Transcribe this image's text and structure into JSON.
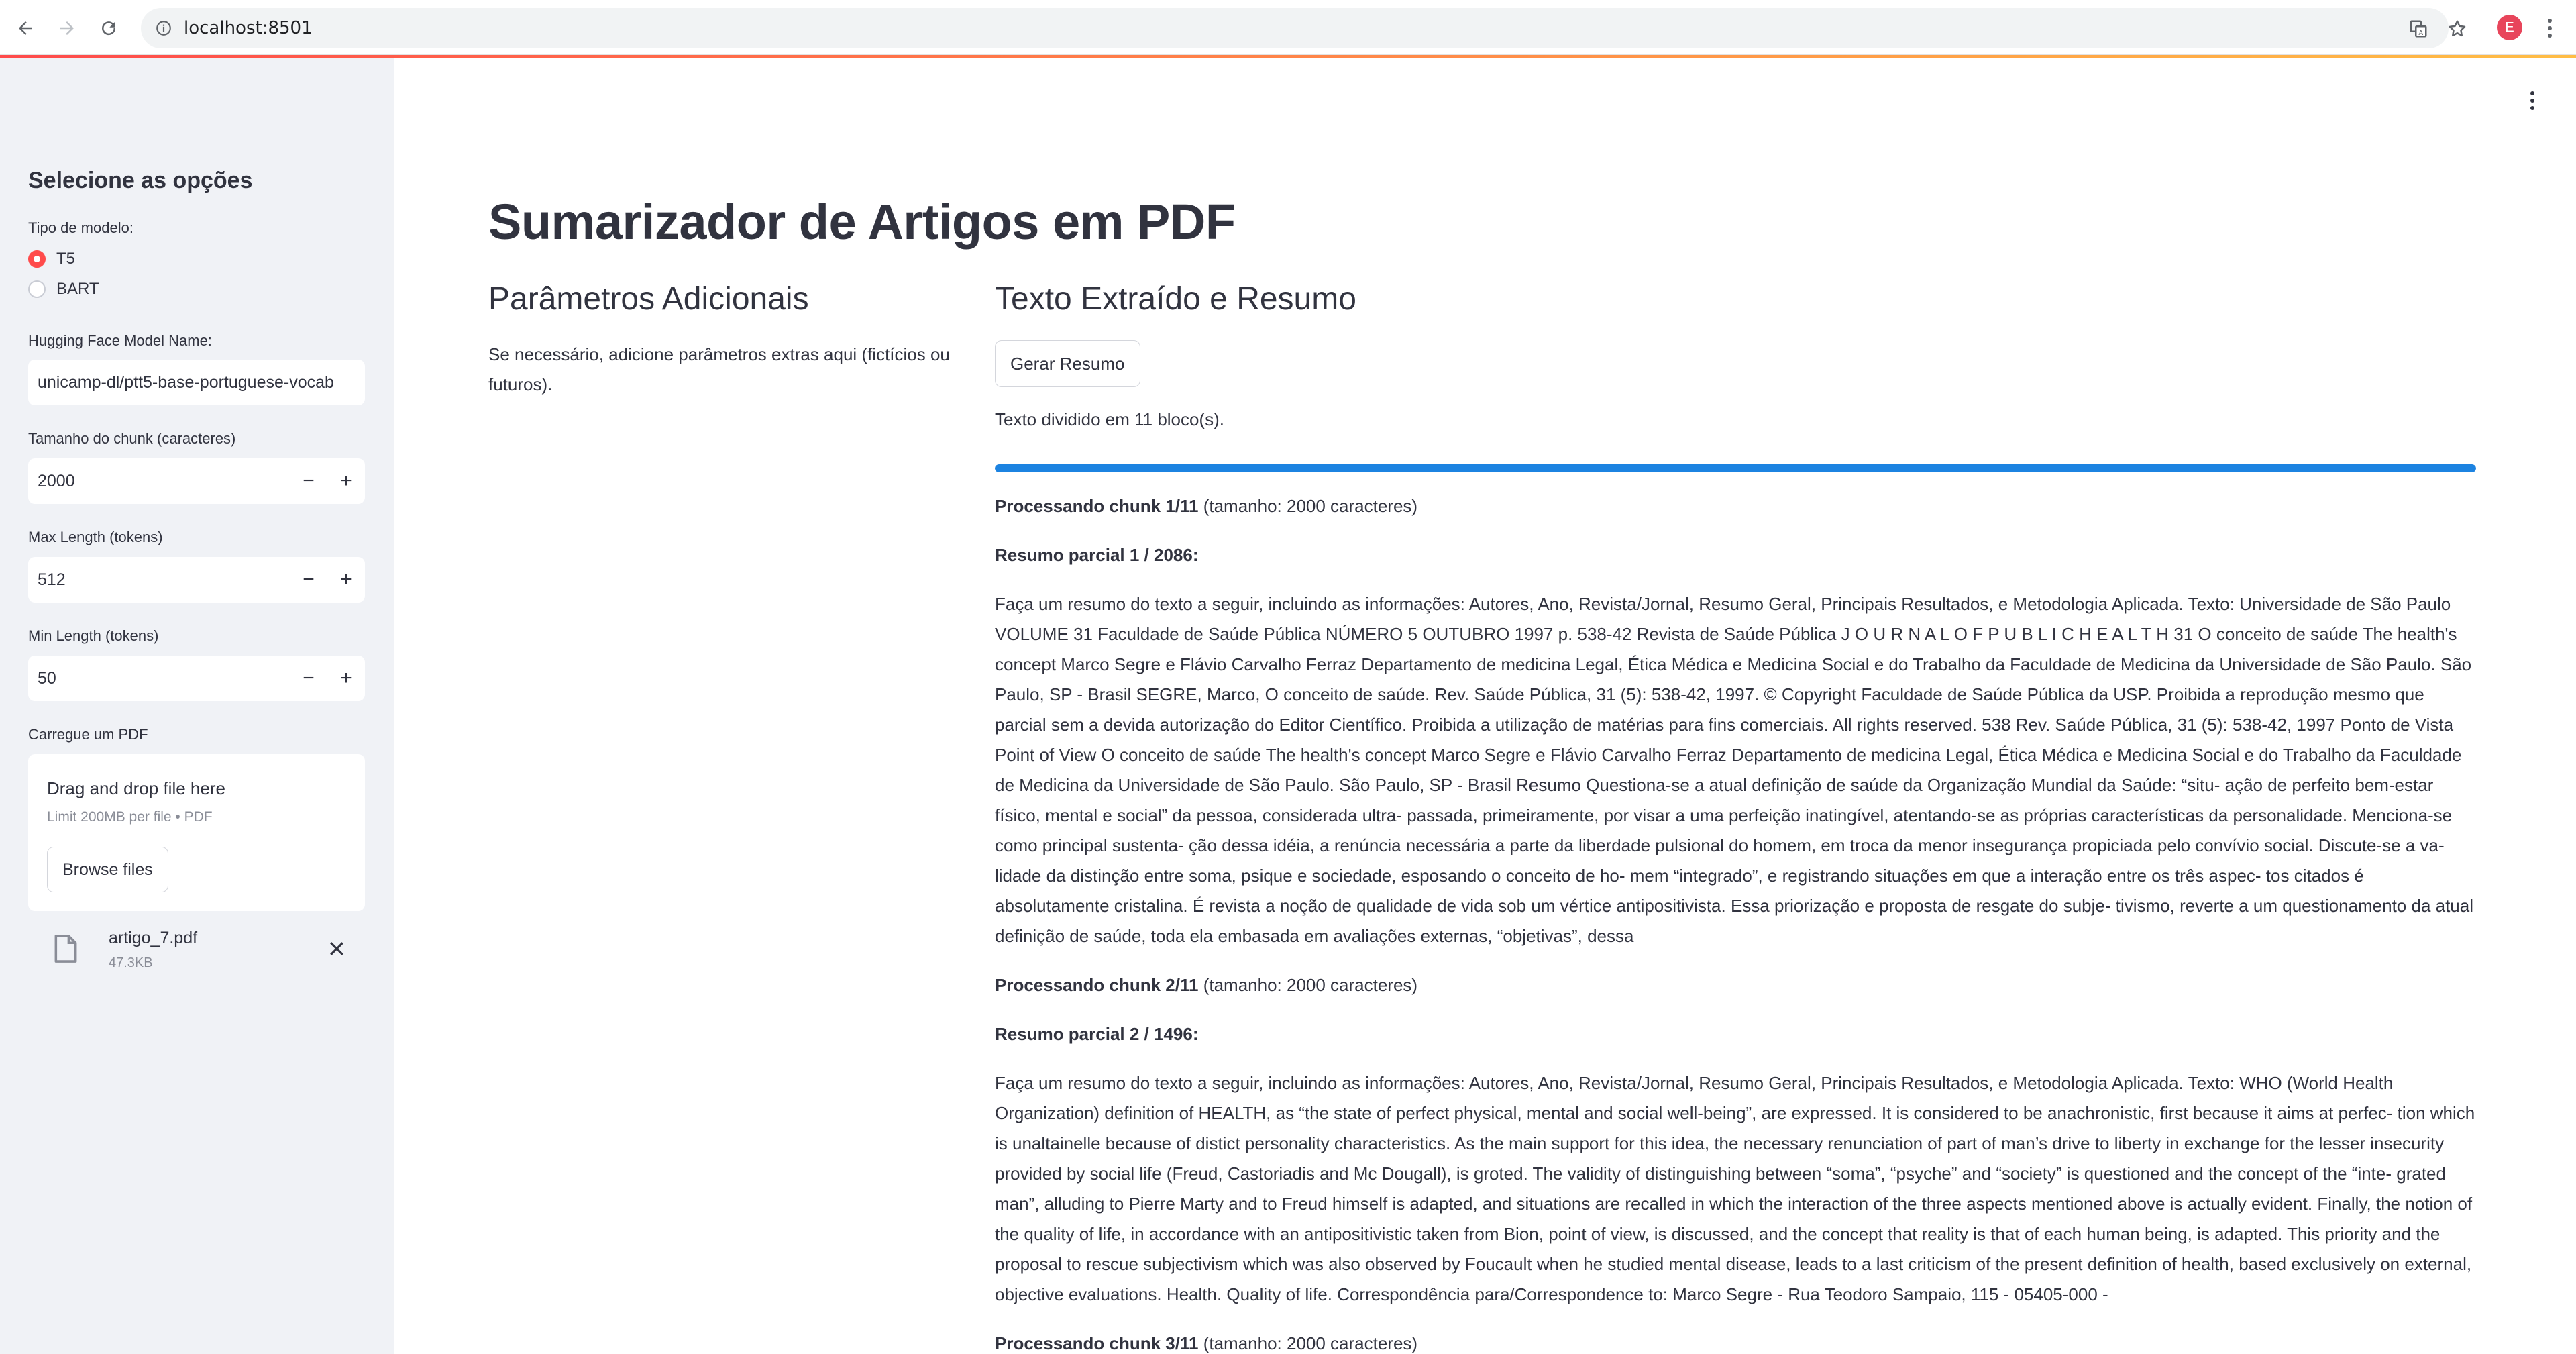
{
  "browser": {
    "url": "localhost:8501",
    "profile_initial": "E"
  },
  "sidebar": {
    "title": "Selecione as opções",
    "model_type_label": "Tipo de modelo:",
    "model_options": [
      {
        "label": "T5",
        "selected": true
      },
      {
        "label": "BART",
        "selected": false
      }
    ],
    "hf_label": "Hugging Face Model Name:",
    "hf_value": "unicamp-dl/ptt5-base-portuguese-vocab",
    "chunk_label": "Tamanho do chunk (caracteres)",
    "chunk_value": "2000",
    "maxlen_label": "Max Length (tokens)",
    "maxlen_value": "512",
    "minlen_label": "Min Length (tokens)",
    "minlen_value": "50",
    "upload_label": "Carregue um PDF",
    "upload_drag": "Drag and drop file here",
    "upload_limit": "Limit 200MB per file • PDF",
    "browse_label": "Browse files",
    "file_name": "artigo_7.pdf",
    "file_size": "47.3KB"
  },
  "main": {
    "title": "Sumarizador de Artigos em PDF",
    "col1_heading": "Parâmetros Adicionais",
    "col1_text": "Se necessário, adicione parâmetros extras aqui (fictícios ou futuros).",
    "col2_heading": "Texto Extraído e Resumo",
    "gerar_label": "Gerar Resumo",
    "divided_text": "Texto dividido em 11 bloco(s).",
    "progress_fraction": 1.0,
    "blocks": [
      {
        "chunk_title": "Processando chunk 1/11",
        "chunk_size": " (tamanho: 2000 caracteres)",
        "partial_title": "Resumo parcial 1 / 2086:",
        "text": "Faça um resumo do texto a seguir, incluindo as informações: Autores, Ano, Revista/Jornal, Resumo Geral, Principais Resultados, e Metodologia Aplicada. Texto: Universidade de São Paulo VOLUME 31 Faculdade de Saúde Pública NÚMERO 5 OUTUBRO 1997 p. 538-42 Revista de Saúde Pública J O U R N A L O F P U B L I C H E A L T H 31 O conceito de saúde The health's concept Marco Segre e Flávio Carvalho Ferraz Departamento de medicina Legal, Ética Médica e Medicina Social e do Trabalho da Faculdade de Medicina da Universidade de São Paulo. São Paulo, SP - Brasil SEGRE, Marco, O conceito de saúde. Rev. Saúde Pública, 31 (5): 538-42, 1997. © Copyright Faculdade de Saúde Pública da USP. Proibida a reprodução mesmo que parcial sem a devida autorização do Editor Científico. Proibida a utilização de matérias para fins comerciais. All rights reserved. 538 Rev. Saúde Pública, 31 (5): 538-42, 1997 Ponto de Vista Point of View O conceito de saúde The health's concept Marco Segre e Flávio Carvalho Ferraz Departamento de medicina Legal, Ética Médica e Medicina Social e do Trabalho da Faculdade de Medicina da Universidade de São Paulo. São Paulo, SP - Brasil Resumo Questiona-se a atual definição de saúde da Organização Mundial da Saúde: “situ- ação de perfeito bem-estar físico, mental e social” da pessoa, considerada ultra- passada, primeiramente, por visar a uma perfeição inatingível, atentando-se as próprias características da personalidade. Menciona-se como principal sustenta- ção dessa idéia, a renúncia necessária a parte da liberdade pulsional do homem, em troca da menor insegurança propiciada pelo convívio social. Discute-se a va- lidade da distinção entre soma, psique e sociedade, esposando o conceito de ho- mem “integrado”, e registrando situações em que a interação entre os três aspec- tos citados é absolutamente cristalina. É revista a noção de qualidade de vida sob um vértice antipositivista. Essa priorização e proposta de resgate do subje- tivismo, reverte a um questionamento da atual definição de saúde, toda ela embasada em avaliações externas, “objetivas”, dessa"
      },
      {
        "chunk_title": "Processando chunk 2/11",
        "chunk_size": " (tamanho: 2000 caracteres)",
        "partial_title": "Resumo parcial 2 / 1496:",
        "text": "Faça um resumo do texto a seguir, incluindo as informações: Autores, Ano, Revista/Jornal, Resumo Geral, Principais Resultados, e Metodologia Aplicada. Texto: WHO (World Health Organization) definition of HEALTH, as “the state of perfect physical, mental and social well-being”, are expressed. It is considered to be anachronistic, first because it aims at perfec- tion which is unaltainelle because of distict personality characteristics. As the main support for this idea, the necessary renunciation of part of man’s drive to liberty in exchange for the lesser insecurity provided by social life (Freud, Castoriadis and Mc Dougall), is groted. The validity of distinguishing between “soma”, “psyche” and “society” is questioned and the concept of the “inte- grated man”, alluding to Pierre Marty and to Freud himself is adapted, and situations are recalled in which the interaction of the three aspects mentioned above is actually evident. Finally, the notion of the quality of life, in accordance with an antipositivistic taken from Bion, point of view, is discussed, and the concept that reality is that of each human being, is adapted. This priority and the proposal to rescue subjectivism which was also observed by Foucault when he studied mental disease, leads to a last criticism of the present definition of health, based exclusively on external, objective evaluations. Health. Quality of life. Correspondência para/Correspondence to: Marco Segre - Rua Teodoro Sampaio, 115 - 05405-000 -"
      },
      {
        "chunk_title": "Processando chunk 3/11",
        "chunk_size": " (tamanho: 2000 caracteres)"
      }
    ]
  }
}
